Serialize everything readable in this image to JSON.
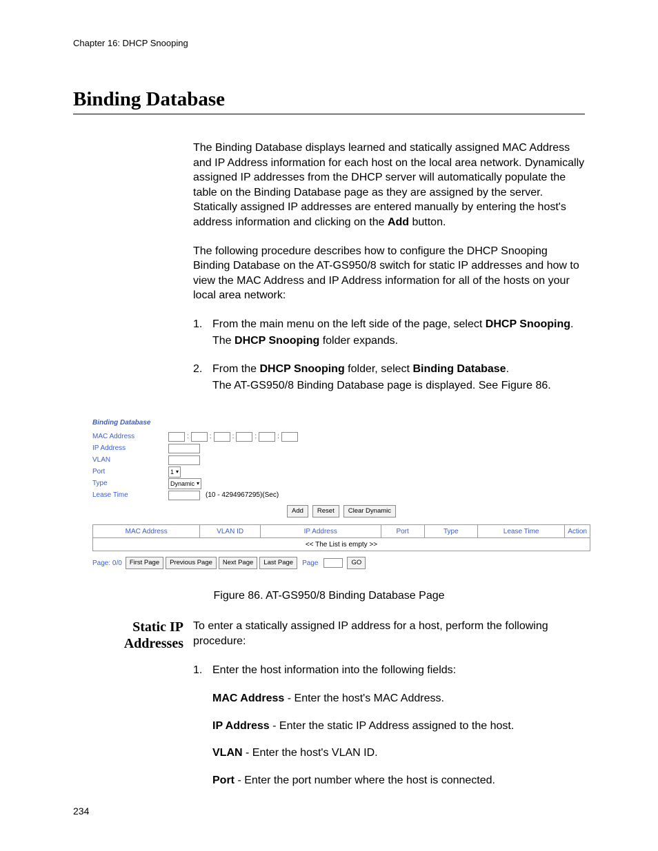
{
  "chapter": "Chapter 16: DHCP Snooping",
  "h1": "Binding Database",
  "intro_para_pre": "The Binding Database displays learned and statically assigned MAC Address and IP Address information for each host on the local area network. Dynamically assigned IP addresses from the DHCP server will automatically populate the table on the Binding Database page as they are assigned by the server. Statically assigned IP addresses are entered manually by entering the host's address information and clicking on the ",
  "intro_para_bold": "Add",
  "intro_para_post": " button.",
  "para2": "The following procedure describes how to configure the DHCP Snooping Binding Database on the AT-GS950/8 switch for static IP addresses and how to view the MAC Address and IP Address information for all of the hosts on your local area network:",
  "step1_num": "1.",
  "step1_pre": "From the main menu on the left side of the page, select ",
  "step1_bold1": "DHCP Snooping",
  "step1_post1": ".",
  "step1_line2_pre": "The ",
  "step1_line2_bold": "DHCP Snooping",
  "step1_line2_post": " folder expands.",
  "step2_num": "2.",
  "step2_pre": "From the ",
  "step2_bold1": "DHCP Snooping",
  "step2_mid": " folder, select ",
  "step2_bold2": "Binding Database",
  "step2_post": ".",
  "step2_line2": "The AT-GS950/8 Binding Database page is displayed. See Figure 86.",
  "ui": {
    "title": "Binding Database",
    "labels": {
      "mac": "MAC Address",
      "ip": "IP Address",
      "vlan": "VLAN",
      "port": "Port",
      "type": "Type",
      "lease": "Lease Time"
    },
    "port_value": "1",
    "type_value": "Dynamic",
    "lease_hint": "(10 - 4294967295)(Sec)",
    "buttons": {
      "add": "Add",
      "reset": "Reset",
      "clear": "Clear Dynamic"
    },
    "table_headers": [
      "MAC Address",
      "VLAN ID",
      "IP Address",
      "Port",
      "Type",
      "Lease Time",
      "Action"
    ],
    "empty_text": "<< The List is empty >>",
    "pager": {
      "label": "Page: 0/0",
      "first": "First Page",
      "prev": "Previous Page",
      "next": "Next Page",
      "last": "Last Page",
      "page_word": "Page",
      "go": "GO"
    }
  },
  "fig_caption": "Figure 86. AT-GS950/8 Binding Database Page",
  "side_heading_l1": "Static IP",
  "side_heading_l2": "Addresses",
  "static_intro": "To enter a statically assigned IP address for a host, perform the following procedure:",
  "static_step1_num": "1.",
  "static_step1": "Enter the host information into the following fields:",
  "fields": {
    "mac_b": "MAC Address",
    "mac_t": " - Enter the host's MAC Address.",
    "ip_b": "IP Address",
    "ip_t": " - Enter the static IP Address assigned to the host.",
    "vlan_b": "VLAN",
    "vlan_t": " - Enter the host's VLAN ID.",
    "port_b": "Port",
    "port_t": " - Enter the port number where the host is connected."
  },
  "page_number": "234"
}
